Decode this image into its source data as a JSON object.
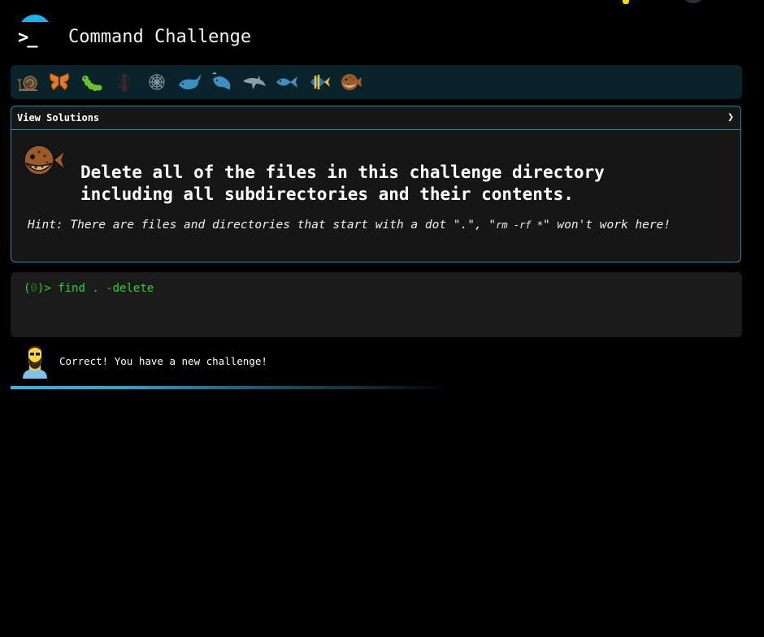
{
  "app": {
    "title": "Command Challenge",
    "logo_icon": "terminal-prompt-icon"
  },
  "levels": [
    {
      "name": "snail",
      "icon": "snail-icon"
    },
    {
      "name": "butterfly",
      "icon": "butterfly-icon"
    },
    {
      "name": "caterpillar",
      "icon": "caterpillar-icon"
    },
    {
      "name": "ant",
      "icon": "ant-icon"
    },
    {
      "name": "spider-web",
      "icon": "spider-web-icon"
    },
    {
      "name": "whale",
      "icon": "whale-icon"
    },
    {
      "name": "spouting-whale",
      "icon": "spouting-whale-icon"
    },
    {
      "name": "dolphin",
      "icon": "dolphin-icon"
    },
    {
      "name": "fish",
      "icon": "fish-icon"
    },
    {
      "name": "tropical-fish",
      "icon": "tropical-fish-icon"
    },
    {
      "name": "blowfish",
      "icon": "blowfish-icon"
    }
  ],
  "panel": {
    "view_solutions": "View Solutions",
    "chevron": "❯",
    "challenge_line1": "Delete all of the files in this challenge directory",
    "challenge_line2": "including all subdirectories and their contents.",
    "hint_prefix": "Hint: There are files and directories that start with a dot \".\", \"",
    "hint_code": "rm -rf *",
    "hint_suffix": "\" won't work here!"
  },
  "terminal": {
    "prompt_open": "(",
    "exit_code": "0",
    "prompt_close": ")> ",
    "command": "find . -delete"
  },
  "response": {
    "message": "Correct! You have a new challenge!"
  },
  "colors": {
    "accent": "#1e88a8",
    "terminal_green": "#29d429",
    "progress": "#2bb7e6"
  }
}
